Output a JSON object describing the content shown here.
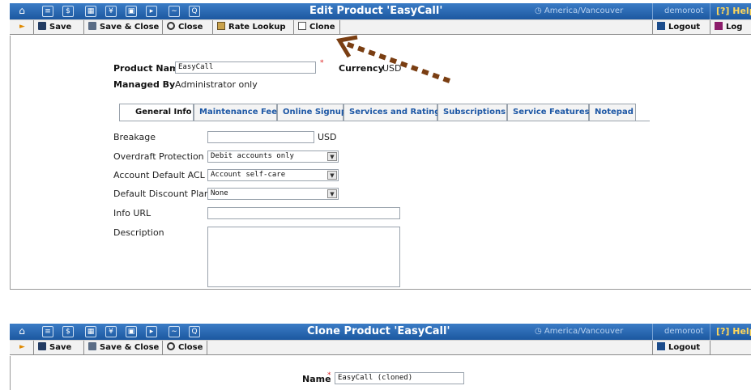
{
  "nav_icons": [
    "home-icon",
    "list-icon",
    "dollar-icon",
    "grid-icon",
    "person-icon",
    "network-icon",
    "route-icon",
    "chart-icon",
    "search-icon"
  ],
  "edit": {
    "title": "Edit Product 'EasyCall'",
    "timezone": "America/Vancouver",
    "user": "demoroot",
    "help": "Help",
    "toolbar": {
      "save": "Save",
      "save_close": "Save & Close",
      "close": "Close",
      "rate_lookup": "Rate Lookup",
      "clone": "Clone",
      "logout": "Logout",
      "log": "Log"
    },
    "product_name_label": "Product Name",
    "product_name_value": "EasyCall",
    "currency_label": "Currency",
    "currency_value": "USD",
    "managed_by_label": "Managed By",
    "managed_by_value": "Administrator only",
    "tabs": [
      "General Info",
      "Maintenance Fee",
      "Online Signup",
      "Services and Rating",
      "Subscriptions",
      "Service Features",
      "Notepad"
    ],
    "fields": {
      "breakage_label": "Breakage",
      "breakage_value": "",
      "breakage_unit": "USD",
      "overdraft_label": "Overdraft Protection",
      "overdraft_value": "Debit accounts only",
      "acl_label": "Account Default ACL",
      "acl_value": "Account self-care",
      "discount_label": "Default Discount Plan",
      "discount_value": "None",
      "info_url_label": "Info URL",
      "info_url_value": "",
      "description_label": "Description",
      "description_value": ""
    }
  },
  "clone": {
    "title": "Clone Product 'EasyCall'",
    "timezone": "America/Vancouver",
    "user": "demoroot",
    "help": "Help",
    "toolbar": {
      "save": "Save",
      "save_close": "Save & Close",
      "close": "Close",
      "logout": "Logout"
    },
    "name_label": "Name",
    "name_value": "EasyCall (cloned)"
  },
  "colors": {
    "topbar": "#1f5fa8",
    "link_tab": "#1d57a5",
    "annotation_arrow": "#7a3e12",
    "required": "#dd2222"
  }
}
